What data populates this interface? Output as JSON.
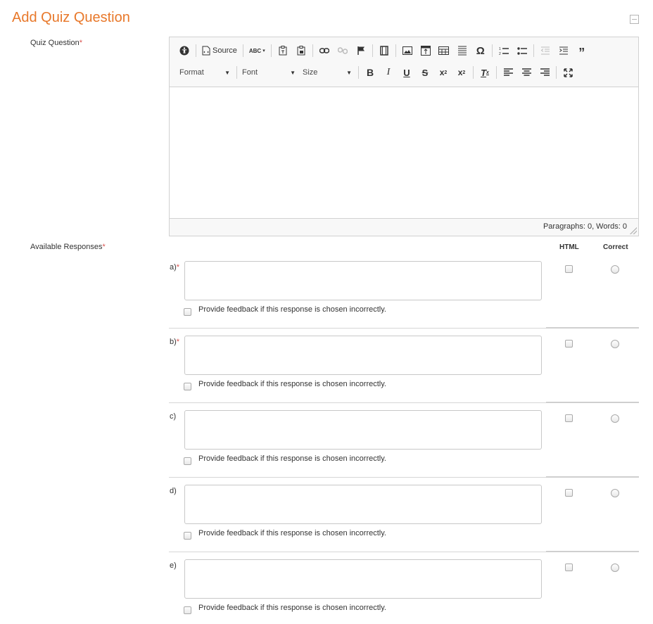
{
  "page": {
    "title": "Add Quiz Question",
    "collapse_icon": "collapse-minus-icon"
  },
  "quiz_question": {
    "label": "Quiz Question",
    "required_mark": "*",
    "editor": {
      "toolbar_row1": [
        {
          "name": "accessibility-icon",
          "glyph": "♿"
        },
        {
          "name": "source-button",
          "label": "Source"
        },
        {
          "name": "spellcheck-icon",
          "glyph": "ABC"
        },
        {
          "name": "paste-text-icon",
          "glyph": "📋"
        },
        {
          "name": "paste-word-icon",
          "glyph": "📋"
        },
        {
          "name": "link-icon",
          "glyph": "🔗"
        },
        {
          "name": "unlink-icon",
          "glyph": "⛓"
        },
        {
          "name": "anchor-flag-icon",
          "glyph": "⚑"
        },
        {
          "name": "video-icon",
          "glyph": "🎞"
        },
        {
          "name": "image-icon",
          "glyph": "🖼"
        },
        {
          "name": "template-icon",
          "glyph": "▣"
        },
        {
          "name": "table-icon",
          "glyph": "▦"
        },
        {
          "name": "horizontal-line-icon",
          "glyph": "≣"
        },
        {
          "name": "special-char-icon",
          "glyph": "Ω"
        },
        {
          "name": "numbered-list-icon",
          "glyph": "⒈"
        },
        {
          "name": "bulleted-list-icon",
          "glyph": "•"
        },
        {
          "name": "outdent-icon",
          "glyph": "⇤"
        },
        {
          "name": "indent-icon",
          "glyph": "⇥"
        },
        {
          "name": "blockquote-icon",
          "glyph": "❞"
        }
      ],
      "format_label": "Format",
      "font_label": "Font",
      "size_label": "Size",
      "toolbar_row2": [
        {
          "name": "bold-icon",
          "glyph": "B"
        },
        {
          "name": "italic-icon",
          "glyph": "I"
        },
        {
          "name": "underline-icon",
          "glyph": "U"
        },
        {
          "name": "strikethrough-icon",
          "glyph": "S"
        },
        {
          "name": "subscript-icon",
          "glyph": "X₂"
        },
        {
          "name": "superscript-icon",
          "glyph": "X²"
        },
        {
          "name": "remove-format-icon",
          "glyph": "Tx"
        },
        {
          "name": "align-left-icon",
          "glyph": "≡"
        },
        {
          "name": "align-center-icon",
          "glyph": "≡"
        },
        {
          "name": "align-right-icon",
          "glyph": "≡"
        },
        {
          "name": "maximize-icon",
          "glyph": "⤢"
        }
      ],
      "status": "Paragraphs: 0, Words: 0"
    }
  },
  "responses": {
    "label": "Available Responses",
    "required_mark": "*",
    "html_header": "HTML",
    "correct_header": "Correct",
    "feedback_label": "Provide feedback if this response is chosen incorrectly.",
    "items": [
      {
        "letter": "a)",
        "required": "*"
      },
      {
        "letter": "b)",
        "required": "*"
      },
      {
        "letter": "c)",
        "required": ""
      },
      {
        "letter": "d)",
        "required": ""
      },
      {
        "letter": "e)",
        "required": ""
      }
    ]
  },
  "colors": {
    "title": "#e8782a",
    "required": "#d9534f",
    "toolbar_bg": "#f8f8f8",
    "border": "#d1d1d1"
  }
}
